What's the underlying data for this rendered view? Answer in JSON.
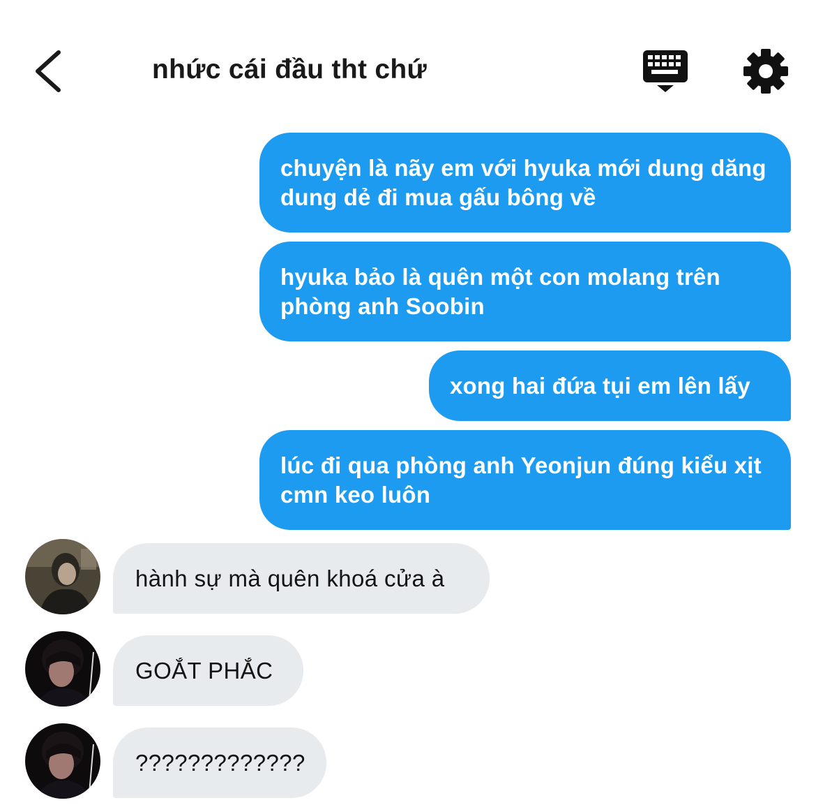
{
  "header": {
    "title": "nhức cái đầu tht chứ",
    "back_icon": "chevron-left-icon",
    "keyboard_icon": "keyboard-icon",
    "settings_icon": "gear-icon"
  },
  "messages": {
    "sent": [
      "chuyện là nãy em với hyuka mới dung dăng dung dẻ đi mua gấu bông về",
      "hyuka bảo là quên một con molang trên phòng anh Soobin",
      "xong hai đứa tụi em lên lấy",
      "lúc đi qua phòng anh Yeonjun đúng kiểu xịt cmn keo luôn"
    ],
    "received": [
      "hành sự mà quên khoá cửa à",
      "GOẮT PHẮC",
      "?????????????"
    ]
  },
  "colors": {
    "sent_bubble": "#1d9bf0",
    "received_bubble": "#e7ebee",
    "title_text": "#1a1a1a"
  }
}
